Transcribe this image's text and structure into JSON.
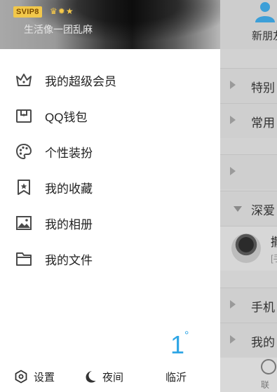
{
  "background_list": {
    "header_label": "新朋友",
    "groups": [
      {
        "label": "特别",
        "collapsed": true
      },
      {
        "label": "常用",
        "collapsed": true
      },
      {
        "label": "",
        "collapsed": true
      },
      {
        "label": "深爱",
        "collapsed": false
      }
    ],
    "contact": {
      "name": "撒",
      "sub": "[手"
    },
    "groups_after": [
      {
        "label": "手机",
        "collapsed": true
      },
      {
        "label": "我的",
        "collapsed": true
      }
    ],
    "bottom_label": "联系"
  },
  "profile": {
    "badge": "SVIP8",
    "level_icons": [
      "crown-icon",
      "sun-icon",
      "star-icon"
    ],
    "signature": "生活像一团乱麻"
  },
  "menu": {
    "items": [
      {
        "label": "我的超级会员",
        "icon": "crown-icon"
      },
      {
        "label": "QQ钱包",
        "icon": "wallet-icon"
      },
      {
        "label": "个性装扮",
        "icon": "palette-icon"
      },
      {
        "label": "我的收藏",
        "icon": "bookmark-star-icon"
      },
      {
        "label": "我的相册",
        "icon": "photo-icon"
      },
      {
        "label": "我的文件",
        "icon": "folder-icon"
      }
    ]
  },
  "weather": {
    "temperature": "1",
    "degree_symbol": "°",
    "city": "临沂"
  },
  "footer": {
    "settings_label": "设置",
    "night_label": "夜间"
  },
  "colors": {
    "accent_blue": "#2fa6e5",
    "svip_gold": "#f2c84b",
    "icon_gray": "#4a4a4a"
  }
}
